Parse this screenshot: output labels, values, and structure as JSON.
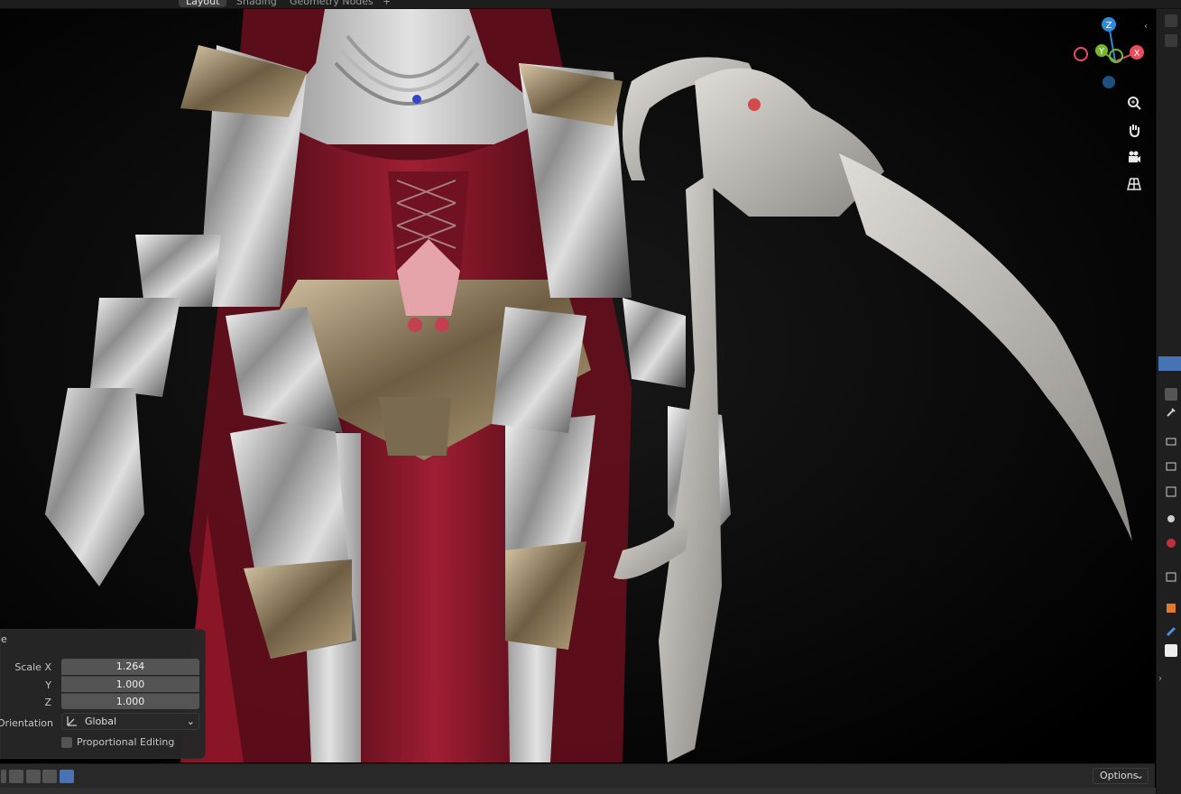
{
  "workspace_tabs": [
    {
      "label": "Layout",
      "active": true
    },
    {
      "label": "Shading",
      "active": false
    },
    {
      "label": "Geometry Nodes",
      "active": false
    },
    {
      "label": "+",
      "active": false
    }
  ],
  "gizmo": {
    "axes": {
      "z": "Z",
      "y": "Y",
      "x": "X"
    },
    "colors": {
      "x": "#e84d5d",
      "y": "#75b62e",
      "z": "#2e8bd9"
    },
    "buttons": [
      "zoom-icon",
      "hand-icon",
      "camera-icon",
      "grid-icon"
    ]
  },
  "operator_panel": {
    "title": "e",
    "fields": [
      {
        "label": "Scale X",
        "value": "1.264"
      },
      {
        "label": "Y",
        "value": "1.000"
      },
      {
        "label": "Z",
        "value": "1.000"
      }
    ],
    "orientation": {
      "label": "Orientation",
      "value": "Global"
    },
    "proportional_editing": {
      "label": "Proportional Editing",
      "checked": false
    }
  },
  "bottom_toolbar": {
    "options_label": "Options",
    "modes": [
      "new-selection",
      "extend",
      "subtract",
      "invert",
      "intersect"
    ]
  },
  "colors": {
    "accent": "#4772b3",
    "panel": "#282828",
    "field": "#545454"
  }
}
